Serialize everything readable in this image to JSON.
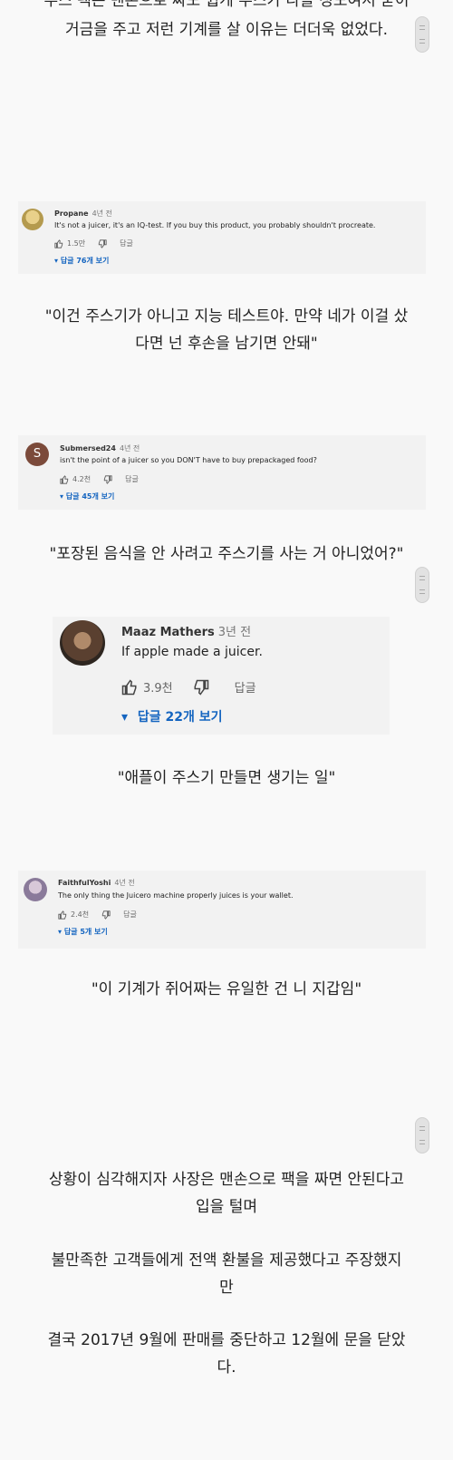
{
  "top_text": {
    "line1": "주스 팩은 맨손으로 짜도 쉽게 주스가 나올 정도여서 굳이",
    "line2": "거금을 주고 저런 기계를 살 이유는 더더욱 없었다."
  },
  "comments": [
    {
      "author": "Propane",
      "time": "4년 전",
      "text": "It's not a juicer, it's an IQ-test. If you buy this product, you probably shouldn't procreate.",
      "likes": "1.5만",
      "reply_label": "답글",
      "view_replies": "답글 76개 보기",
      "avatar_color": "#c9b46a"
    },
    {
      "author": "Submersed24",
      "time": "4년 전",
      "text": "isn't the point of a juicer so you DON'T have to buy prepackaged food?",
      "likes": "4.2천",
      "reply_label": "답글",
      "view_replies": "답글 45개 보기",
      "avatar_letter": "S",
      "avatar_color": "#7b4a3a"
    },
    {
      "author": "Maaz Mathers",
      "time": "3년 전",
      "text": "If apple made a juicer.",
      "likes": "3.9천",
      "reply_label": "답글",
      "view_replies": "답글 22개 보기",
      "avatar_color": "#5a4a3a"
    },
    {
      "author": "FaithfulYoshi",
      "time": "4년 전",
      "text": "The only thing the Juicero machine properly juices is your wallet.",
      "likes": "2.4천",
      "reply_label": "답글",
      "view_replies": "답글 5개 보기",
      "avatar_color": "#8a7a9a"
    }
  ],
  "captions": {
    "c1_line1": "\"이건 주스기가 아니고 지능 테스트야. 만약 네가 이걸 샀",
    "c1_line2": "다면 넌 후손을 남기면 안돼\"",
    "c2": "\"포장된 음식을 안 사려고 주스기를 사는 거 아니었어?\"",
    "c3": "\"애플이 주스기 만들면 생기는 일\"",
    "c4": "\"이 기계가 쥐어짜는 유일한 건 니 지갑임\""
  },
  "bottom_text": {
    "p1_line1": "상황이 심각해지자 사장은 맨손으로 팩을 짜면 안된다고",
    "p1_line2": "입을 털며",
    "p2_line1": "불만족한 고객들에게 전액 환불을 제공했다고 주장했지",
    "p2_line2": "만",
    "p3_line1": "결국 2017년 9월에 판매를 중단하고 12월에 문을 닫았",
    "p3_line2": "다."
  },
  "colors": {
    "background": "#f9f9f9",
    "card": "#f2f2f2",
    "link_blue": "#1565c0"
  }
}
